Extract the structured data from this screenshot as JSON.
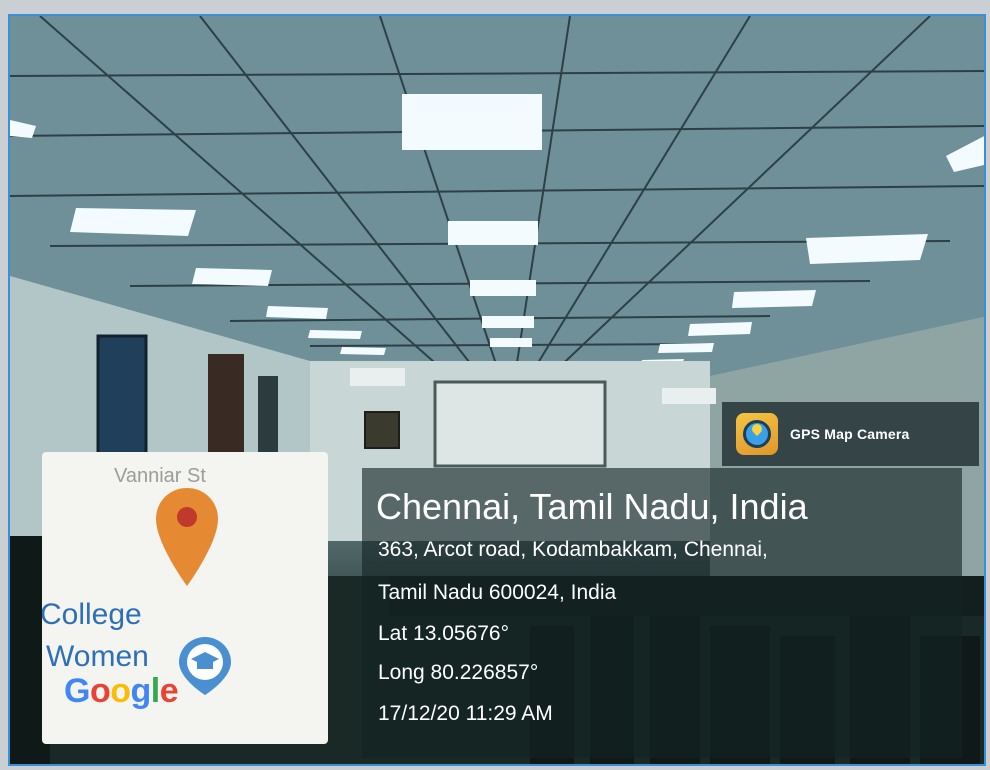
{
  "overlay": {
    "app_name": "GPS Map Camera",
    "app_icon": "gps-map-camera-icon",
    "location_title": "Chennai, Tamil Nadu, India",
    "address_line_1": "363, Arcot road, Kodambakkam, Chennai,",
    "address_line_2": "Tamil Nadu 600024, India",
    "latitude": "Lat 13.05676°",
    "longitude": "Long 80.226857°",
    "datetime": "17/12/20 11:29 AM"
  },
  "map_thumbnail": {
    "road_label": "Vanniar St",
    "poi_label_line_1": "College",
    "poi_label_line_2": "Women",
    "poi_icon": "education-icon",
    "pin_icon": "location-pin-icon",
    "attribution": "Google",
    "attribution_colors": [
      "#4285f4",
      "#ea4335",
      "#fbbc05",
      "#4285f4",
      "#34a853",
      "#ea4335"
    ]
  },
  "colors": {
    "pin": "#e58a33",
    "poi_text": "#2f6fb8",
    "overlay_bg": "#142424"
  }
}
